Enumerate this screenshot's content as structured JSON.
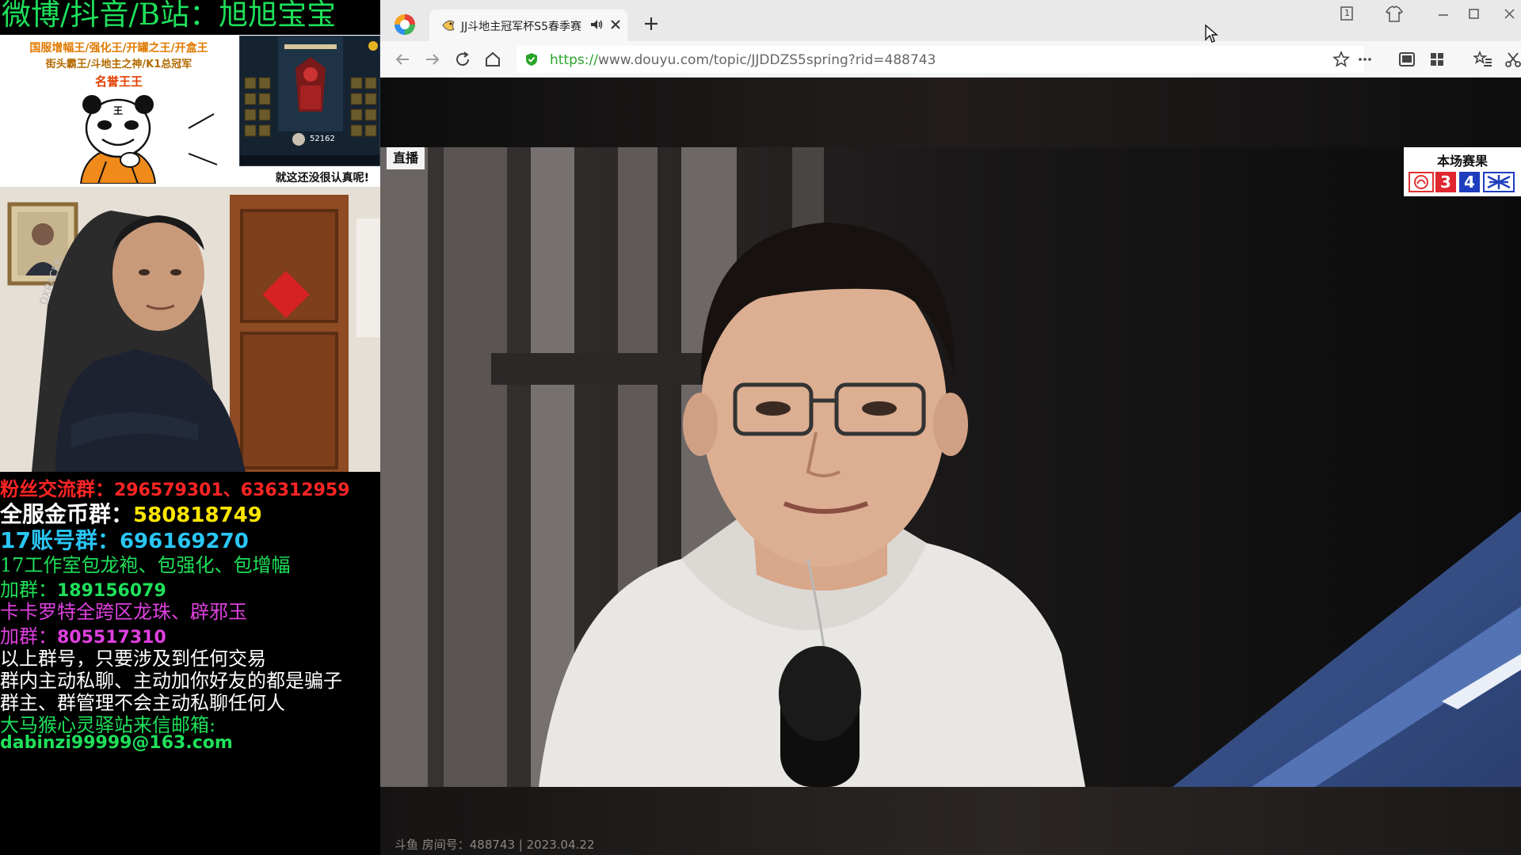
{
  "overlay": {
    "title": "微博/抖音/B站：旭旭宝宝",
    "promo": {
      "line1": "国服增幅王/强化王/开罐之王/开盒王",
      "line2": "街头霸王/斗地主之神/K1总冠军",
      "line3": "名誉王王",
      "game_stat": "52162",
      "caption": "就这还没很认真呢!"
    },
    "groups": {
      "fans_label": "粉丝交流群：",
      "fans_value": "296579301、636312959",
      "gold_label": "全服金币群：",
      "gold_value": "580818749",
      "account_label": "17账号群：",
      "account_value": "696169270",
      "studio_line": "17工作室包龙袍、包强化、包增幅",
      "studio_join_label": "加群：",
      "studio_join_value": "189156079",
      "kakarot_line": "卡卡罗特全跨区龙珠、辟邪玉",
      "kakarot_join_label": "加群：",
      "kakarot_join_value": "805517310",
      "warning1": "以上群号，只要涉及到任何交易",
      "warning2": "群内主动私聊、主动加你好友的都是骗子",
      "warning3": "群主、群管理不会主动私聊任何人",
      "mail_label": "大马猴心灵驿站来信邮箱:",
      "mail_value": "dabinzi99999@163.com"
    }
  },
  "browser": {
    "tab_title": "JJ斗地主冠军杯S5春季赛",
    "tab_count": "1",
    "url_scheme": "https://",
    "url_rest": "www.douyu.com/topic/JJDDZS5spring?rid=488743"
  },
  "video": {
    "live_badge": "直播",
    "score_title": "本场赛果",
    "team_a_score": "3",
    "team_b_score": "4",
    "room_info": "斗鱼 房间号：488743 | 2023.04.22"
  },
  "colors": {
    "overlay_green": "#1ee05a",
    "fans_red": "#ff2424",
    "gold_yellow": "#ffe600",
    "account_cyan": "#29c6f4",
    "kakarot_magenta": "#e040e0",
    "team_a_red": "#e0262e",
    "team_b_blue": "#1d3fbf",
    "url_green": "#2aa52a"
  }
}
